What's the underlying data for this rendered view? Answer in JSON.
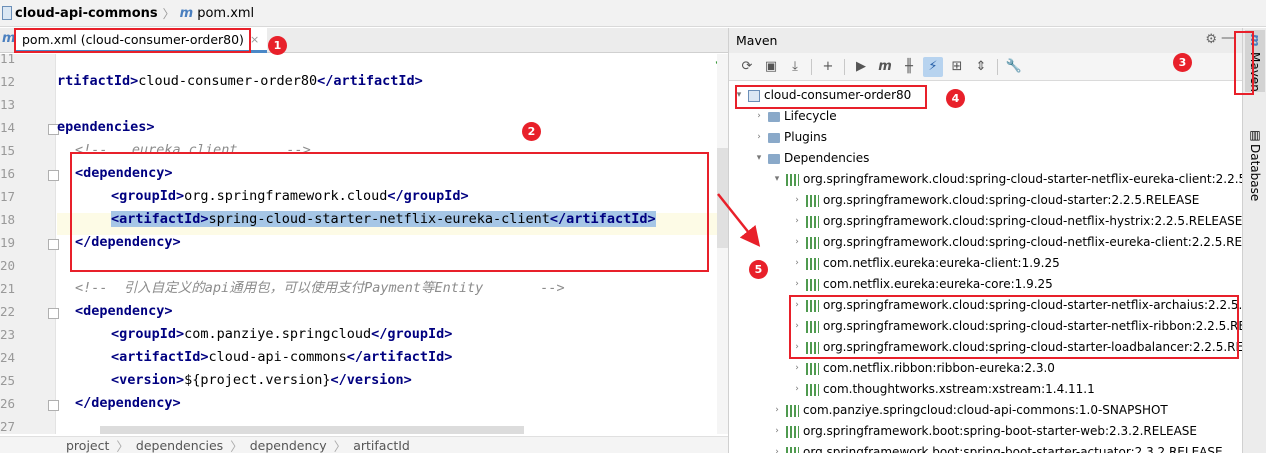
{
  "breadcrumb": {
    "project": "cloud-api-commons",
    "file": "pom.xml"
  },
  "editor": {
    "tab_label": "pom.xml (cloud-consumer-order80)",
    "tab_close": "×",
    "lines": [
      {
        "no": "11",
        "text": ""
      },
      {
        "no": "12",
        "pre": "rtifactId>",
        "val": "cloud-consumer-order80",
        "post": "</artifactId>"
      },
      {
        "no": "13",
        "text": ""
      },
      {
        "no": "14",
        "text": "ependencies>"
      },
      {
        "no": "15",
        "text": "<!--   eureka client      -->"
      },
      {
        "no": "16",
        "text": "<dependency>"
      },
      {
        "no": "17",
        "open": "<groupId>",
        "val": "org.springframework.cloud",
        "close": "</groupId>"
      },
      {
        "no": "18",
        "open": "<artifactId>",
        "val": "spring-cloud-starter-netflix-eureka-client",
        "close": "</artifactId>"
      },
      {
        "no": "19",
        "text": "</dependency>"
      },
      {
        "no": "20",
        "text": ""
      },
      {
        "no": "21",
        "text": "<!--  引入自定义的api通用包，可以使用支付Payment等Entity       -->"
      },
      {
        "no": "22",
        "text": "<dependency>"
      },
      {
        "no": "23",
        "open": "<groupId>",
        "val": "com.panziye.springcloud",
        "close": "</groupId>"
      },
      {
        "no": "24",
        "open": "<artifactId>",
        "val": "cloud-api-commons",
        "close": "</artifactId>"
      },
      {
        "no": "25",
        "open": "<version>",
        "val": "${project.version}",
        "close": "</version>"
      },
      {
        "no": "26",
        "text": "</dependency>"
      },
      {
        "no": "27",
        "text": ""
      }
    ]
  },
  "status_path": [
    "project",
    "dependencies",
    "dependency",
    "artifactId"
  ],
  "maven": {
    "title": "Maven",
    "root": "cloud-consumer-order80",
    "lifecycle": "Lifecycle",
    "plugins": "Plugins",
    "dependencies": "Dependencies",
    "deps": [
      {
        "label": "org.springframework.cloud:spring-cloud-starter-netflix-eureka-client:2.2.5.R",
        "level": 1,
        "open": true
      },
      {
        "label": "org.springframework.cloud:spring-cloud-starter:2.2.5.RELEASE",
        "level": 2
      },
      {
        "label": "org.springframework.cloud:spring-cloud-netflix-hystrix:2.2.5.RELEASE",
        "level": 2
      },
      {
        "label": "org.springframework.cloud:spring-cloud-netflix-eureka-client:2.2.5.RELE",
        "level": 2
      },
      {
        "label": "com.netflix.eureka:eureka-client:1.9.25",
        "level": 2
      },
      {
        "label": "com.netflix.eureka:eureka-core:1.9.25",
        "level": 2
      },
      {
        "label": "org.springframework.cloud:spring-cloud-starter-netflix-archaius:2.2.5.R",
        "level": 2
      },
      {
        "label": "org.springframework.cloud:spring-cloud-starter-netflix-ribbon:2.2.5.REL",
        "level": 2
      },
      {
        "label": "org.springframework.cloud:spring-cloud-starter-loadbalancer:2.2.5.RE",
        "level": 2
      },
      {
        "label": "com.netflix.ribbon:ribbon-eureka:2.3.0",
        "level": 2
      },
      {
        "label": "com.thoughtworks.xstream:xstream:1.4.11.1",
        "level": 2
      },
      {
        "label": "com.panziye.springcloud:cloud-api-commons:1.0-SNAPSHOT",
        "level": 1
      },
      {
        "label": "org.springframework.boot:spring-boot-starter-web:2.3.2.RELEASE",
        "level": 1
      },
      {
        "label": "org.springframework.boot:spring-boot-starter-actuator:2.3.2.RELEASE",
        "level": 1
      }
    ]
  },
  "sidebar": {
    "maven": "Maven",
    "database": "Database"
  },
  "annotations": [
    "1",
    "2",
    "3",
    "4",
    "5"
  ],
  "colors": {
    "annotation": "#e8202a",
    "tag": "#000080",
    "selection": "#a6c6e6"
  }
}
